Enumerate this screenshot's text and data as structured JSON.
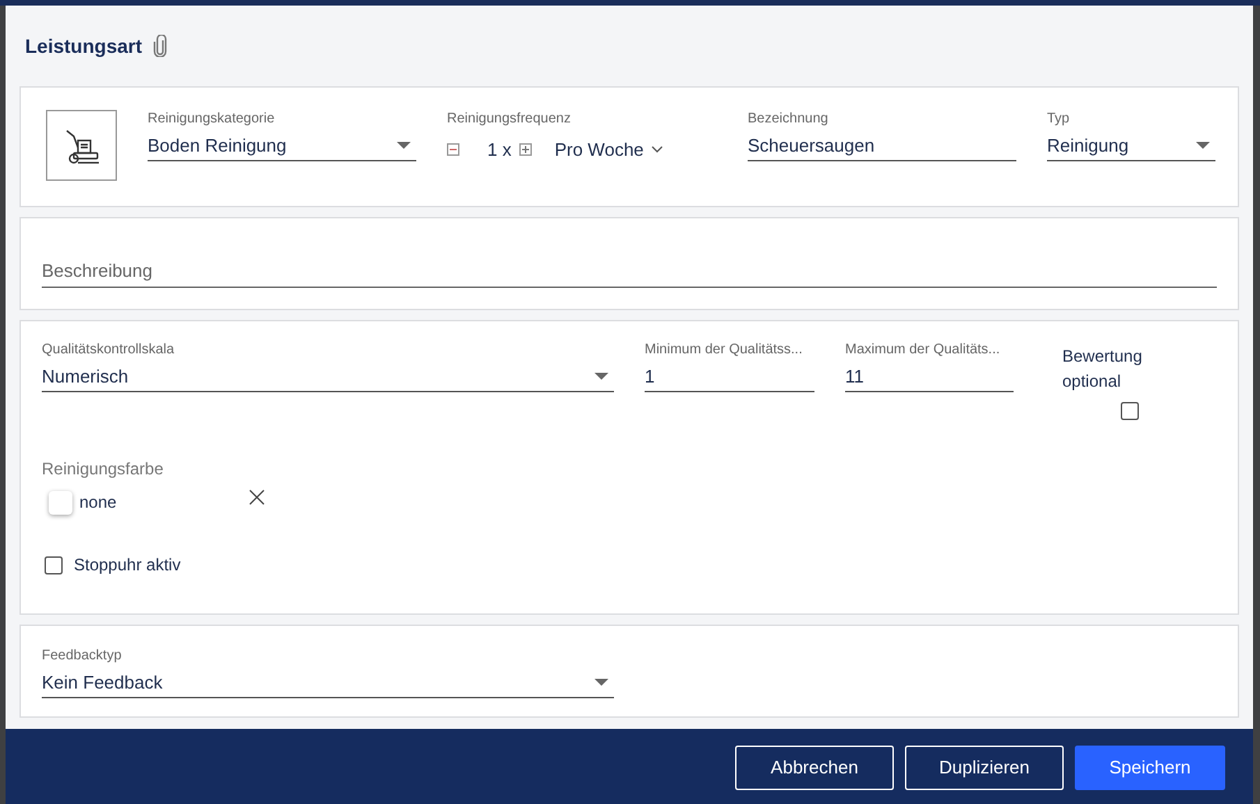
{
  "dialog": {
    "title": "Leistungsart"
  },
  "main_card": {
    "fields": [
      {
        "kind": "select",
        "label": "Reinigungskategorie",
        "value": "Boden Reinigung"
      },
      {
        "kind": "frequency",
        "label": "Reinigungsfrequenz",
        "count": "1 x",
        "unit": "Pro Woche"
      },
      {
        "kind": "text",
        "label": "Bezeichnung",
        "value": "Scheuersaugen"
      },
      {
        "kind": "select",
        "label": "Typ",
        "value": "Reinigung"
      }
    ]
  },
  "description": {
    "placeholder": "Beschreibung"
  },
  "quality": {
    "fields": [
      {
        "kind": "select",
        "label": "Qualitätskontrollskala",
        "value": "Numerisch"
      },
      {
        "kind": "text",
        "label": "Minimum der Qualitätss...",
        "value": "1"
      },
      {
        "kind": "text",
        "label": "Maximum der Qualitäts...",
        "value": "11"
      }
    ],
    "optional": {
      "label": "Bewertung optional",
      "checked": false
    },
    "color": {
      "label": "Reinigungsfarbe",
      "value": "none"
    },
    "stopwatch": {
      "label": "Stoppuhr aktiv",
      "checked": false
    }
  },
  "feedback": {
    "kind": "select",
    "label": "Feedbacktyp",
    "value": "Kein Feedback"
  },
  "buttons": [
    {
      "label": "Abbrechen",
      "kind": "outline"
    },
    {
      "label": "Duplizieren",
      "kind": "outline"
    },
    {
      "label": "Speichern",
      "kind": "primary"
    }
  ]
}
